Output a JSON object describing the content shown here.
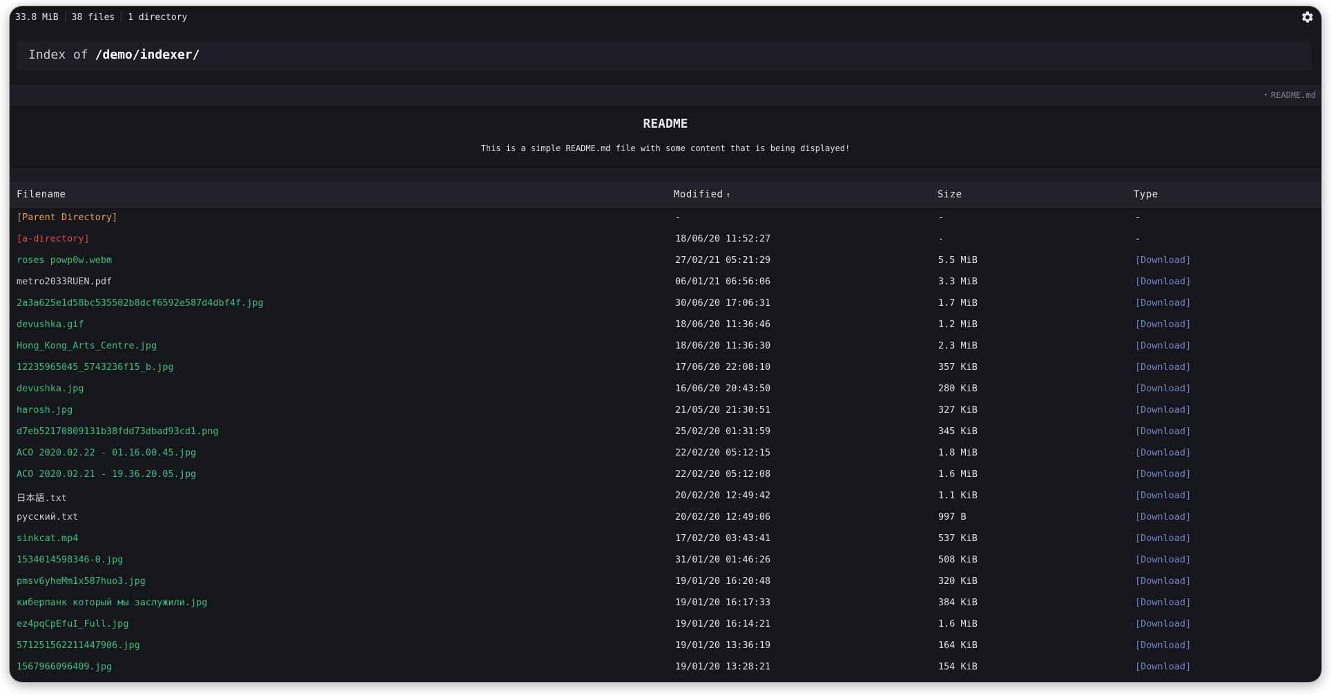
{
  "topbar": {
    "total_size": "33.8 MiB",
    "file_count": "38 files",
    "dir_count": "1 directory"
  },
  "title": {
    "prefix": "Index of",
    "path": "/demo/indexer/"
  },
  "readme": {
    "toggle_label": "README.md",
    "heading": "README",
    "body": "This is a simple README.md file with some content that is being displayed!"
  },
  "table": {
    "headers": {
      "filename": "Filename",
      "modified": "Modified",
      "sort_indicator": "↑",
      "size": "Size",
      "type": "Type"
    },
    "rows": [
      {
        "name": "[Parent Directory]",
        "modified": "-",
        "size": "-",
        "type": "-",
        "kind": "parent"
      },
      {
        "name": "[a-directory]",
        "modified": "18/06/20 11:52:27",
        "size": "-",
        "type": "-",
        "kind": "dir"
      },
      {
        "name": "roses powp0w.webm",
        "modified": "27/02/21 05:21:29",
        "size": "5.5 MiB",
        "type": "[Download]",
        "kind": "file"
      },
      {
        "name": "metro2033RUEN.pdf",
        "modified": "06/01/21 06:56:06",
        "size": "3.3 MiB",
        "type": "[Download]",
        "kind": "plain"
      },
      {
        "name": "2a3a625e1d58bc535502b8dcf6592e587d4dbf4f.jpg",
        "modified": "30/06/20 17:06:31",
        "size": "1.7 MiB",
        "type": "[Download]",
        "kind": "file"
      },
      {
        "name": "devushka.gif",
        "modified": "18/06/20 11:36:46",
        "size": "1.2 MiB",
        "type": "[Download]",
        "kind": "file"
      },
      {
        "name": "Hong_Kong_Arts_Centre.jpg",
        "modified": "18/06/20 11:36:30",
        "size": "2.3 MiB",
        "type": "[Download]",
        "kind": "file"
      },
      {
        "name": "12235965045_5743236f15_b.jpg",
        "modified": "17/06/20 22:08:10",
        "size": "357 KiB",
        "type": "[Download]",
        "kind": "file"
      },
      {
        "name": "devushka.jpg",
        "modified": "16/06/20 20:43:50",
        "size": "280 KiB",
        "type": "[Download]",
        "kind": "file"
      },
      {
        "name": "harosh.jpg",
        "modified": "21/05/20 21:30:51",
        "size": "327 KiB",
        "type": "[Download]",
        "kind": "file"
      },
      {
        "name": "d7eb52170809131b38fdd73dbad93cd1.png",
        "modified": "25/02/20 01:31:59",
        "size": "345 KiB",
        "type": "[Download]",
        "kind": "file"
      },
      {
        "name": "ACO 2020.02.22 - 01.16.00.45.jpg",
        "modified": "22/02/20 05:12:15",
        "size": "1.8 MiB",
        "type": "[Download]",
        "kind": "file"
      },
      {
        "name": "ACO 2020.02.21 - 19.36.20.05.jpg",
        "modified": "22/02/20 05:12:08",
        "size": "1.6 MiB",
        "type": "[Download]",
        "kind": "file"
      },
      {
        "name": "日本語.txt",
        "modified": "20/02/20 12:49:42",
        "size": "1.1 KiB",
        "type": "[Download]",
        "kind": "plain"
      },
      {
        "name": "русский.txt",
        "modified": "20/02/20 12:49:06",
        "size": "997 B",
        "type": "[Download]",
        "kind": "plain"
      },
      {
        "name": "sinkcat.mp4",
        "modified": "17/02/20 03:43:41",
        "size": "537 KiB",
        "type": "[Download]",
        "kind": "file"
      },
      {
        "name": "1534014598346-0.jpg",
        "modified": "31/01/20 01:46:26",
        "size": "508 KiB",
        "type": "[Download]",
        "kind": "file"
      },
      {
        "name": "pmsv6yheMm1x587huo3.jpg",
        "modified": "19/01/20 16:20:48",
        "size": "320 KiB",
        "type": "[Download]",
        "kind": "file"
      },
      {
        "name": "киберпанк который мы заслужили.jpg",
        "modified": "19/01/20 16:17:33",
        "size": "384 KiB",
        "type": "[Download]",
        "kind": "file"
      },
      {
        "name": "ez4pqCpEfuI_Full.jpg",
        "modified": "19/01/20 16:14:21",
        "size": "1.6 MiB",
        "type": "[Download]",
        "kind": "file"
      },
      {
        "name": "571251562211447906.jpg",
        "modified": "19/01/20 13:36:19",
        "size": "164 KiB",
        "type": "[Download]",
        "kind": "file"
      },
      {
        "name": "1567966096409.jpg",
        "modified": "19/01/20 13:28:21",
        "size": "154 KiB",
        "type": "[Download]",
        "kind": "file"
      }
    ]
  },
  "icons": {
    "settings": "gear-icon",
    "readme_toggle": "triangle-down-icon"
  },
  "colors": {
    "background": "#16171c",
    "file_link": "#3ec07a",
    "directory_link": "#e0494b",
    "parent_link": "#e8a05a",
    "download_link": "#6f86c4"
  }
}
